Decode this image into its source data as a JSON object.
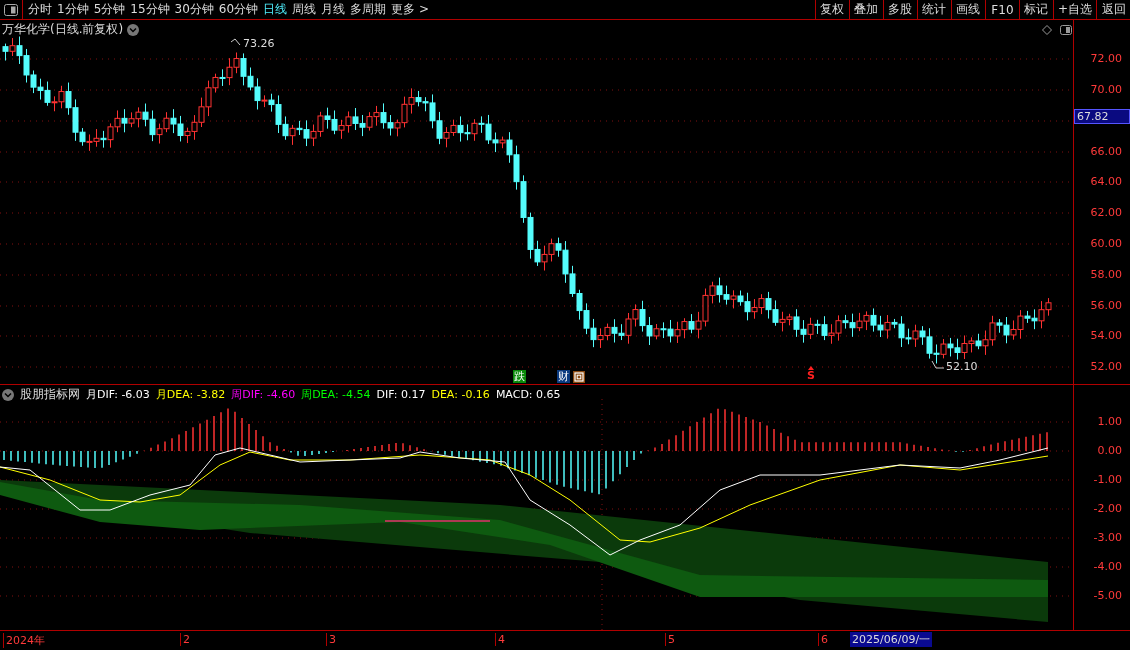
{
  "toolbar": {
    "periods": [
      {
        "label": "分时",
        "selected": false
      },
      {
        "label": "1分钟",
        "selected": false
      },
      {
        "label": "5分钟",
        "selected": false
      },
      {
        "label": "15分钟",
        "selected": false
      },
      {
        "label": "30分钟",
        "selected": false
      },
      {
        "label": "60分钟",
        "selected": false
      },
      {
        "label": "日线",
        "selected": true
      },
      {
        "label": "周线",
        "selected": false
      },
      {
        "label": "月线",
        "selected": false
      },
      {
        "label": "多周期",
        "selected": false
      },
      {
        "label": "更多 >",
        "selected": false
      }
    ],
    "buttons": [
      "复权",
      "叠加",
      "多股",
      "统计",
      "画线",
      "F10",
      "标记",
      "+自选",
      "返回"
    ]
  },
  "stock_title": "万华化学(日线.前复权)",
  "price_axis": {
    "ticks": [
      "72.00",
      "70.00",
      "66.00",
      "64.00",
      "62.00",
      "60.00",
      "58.00",
      "56.00",
      "54.00",
      "52.00"
    ],
    "current_price": "67.82"
  },
  "annotations": {
    "high": "73.26",
    "low": "52.10"
  },
  "signals": [
    {
      "kind": "die",
      "label": "跌"
    },
    {
      "kind": "cai",
      "label": "财"
    },
    {
      "kind": "hui"
    },
    {
      "kind": "sell",
      "label": "S"
    }
  ],
  "indicator": {
    "name": "股朋指标网",
    "legend": [
      {
        "label": "月DIF: -6.03",
        "color": "#ffffff"
      },
      {
        "label": "月DEA: -3.82",
        "color": "#ffff00"
      },
      {
        "label": "周DIF: -4.60",
        "color": "#ff00ff"
      },
      {
        "label": "周DEA: -4.54",
        "color": "#00ff00"
      },
      {
        "label": "DIF: 0.17",
        "color": "#ffffff"
      },
      {
        "label": "DEA: -0.16",
        "color": "#ffff00"
      },
      {
        "label": "MACD: 0.65",
        "color": "#ffffff"
      }
    ],
    "ticks": [
      "1.00",
      "0.00",
      "-1.00",
      "-2.00",
      "-3.00",
      "-4.00",
      "-5.00"
    ]
  },
  "date_axis": {
    "labels": [
      "2024年",
      "2",
      "3",
      "4",
      "5",
      "6"
    ],
    "cursor_date": "2025/06/09/一"
  }
}
